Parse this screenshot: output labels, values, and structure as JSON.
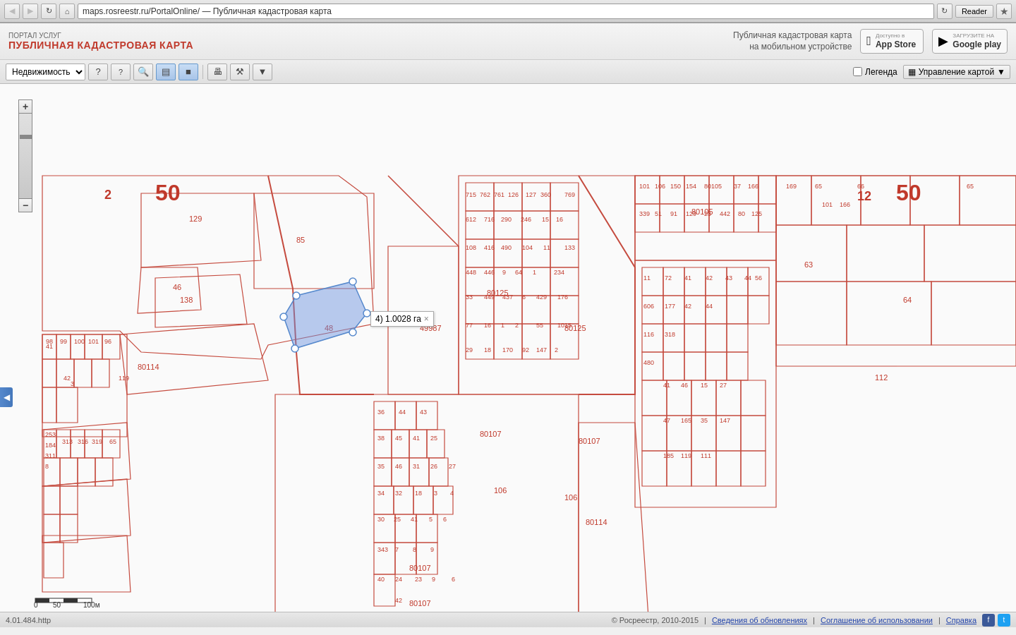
{
  "browser": {
    "url": "maps.rosreestr.ru/PortalOnline/ — Публичная кадастровая карта",
    "reader_label": "Reader"
  },
  "header": {
    "portal_label": "ПОРТАЛ УСЛУГ",
    "title": "ПУБЛИЧНАЯ КАДАСТРОВАЯ КАРТА",
    "mobile_text": "Публичная кадастровая карта\nна мобильном устройстве",
    "appstore_available": "Доступно в",
    "appstore_name": "App Store",
    "googleplay_available": "ЗАГРУЗИТЕ НА",
    "googleplay_name": "Google play"
  },
  "toolbar": {
    "property_select": "Недвижимость",
    "legend_label": "Легенда",
    "map_management_label": "Управление картой"
  },
  "measurement": {
    "label": "4) 1.0028 га",
    "close": "×"
  },
  "status_bar": {
    "version": "4.01.484.http",
    "copyright": "© Росреестр, 2010-2015",
    "update_link": "Сведения об обновлениях",
    "agreement_link": "Соглашение об использовании",
    "help_link": "Справка",
    "separator": "|"
  },
  "scale": {
    "label": "0    50   100м"
  },
  "map_numbers": [
    "50",
    "8",
    "12",
    "50",
    "2",
    "129",
    "46",
    "138",
    "85",
    "41",
    "42",
    "253",
    "184",
    "311",
    "313",
    "316",
    "319",
    "65",
    "8",
    "3",
    "119",
    "80114",
    "49987",
    "48",
    "80125",
    "80105",
    "80107",
    "80107",
    "80107",
    "80114",
    "80125",
    "106",
    "106",
    "112",
    "63",
    "64",
    "65",
    "66"
  ]
}
